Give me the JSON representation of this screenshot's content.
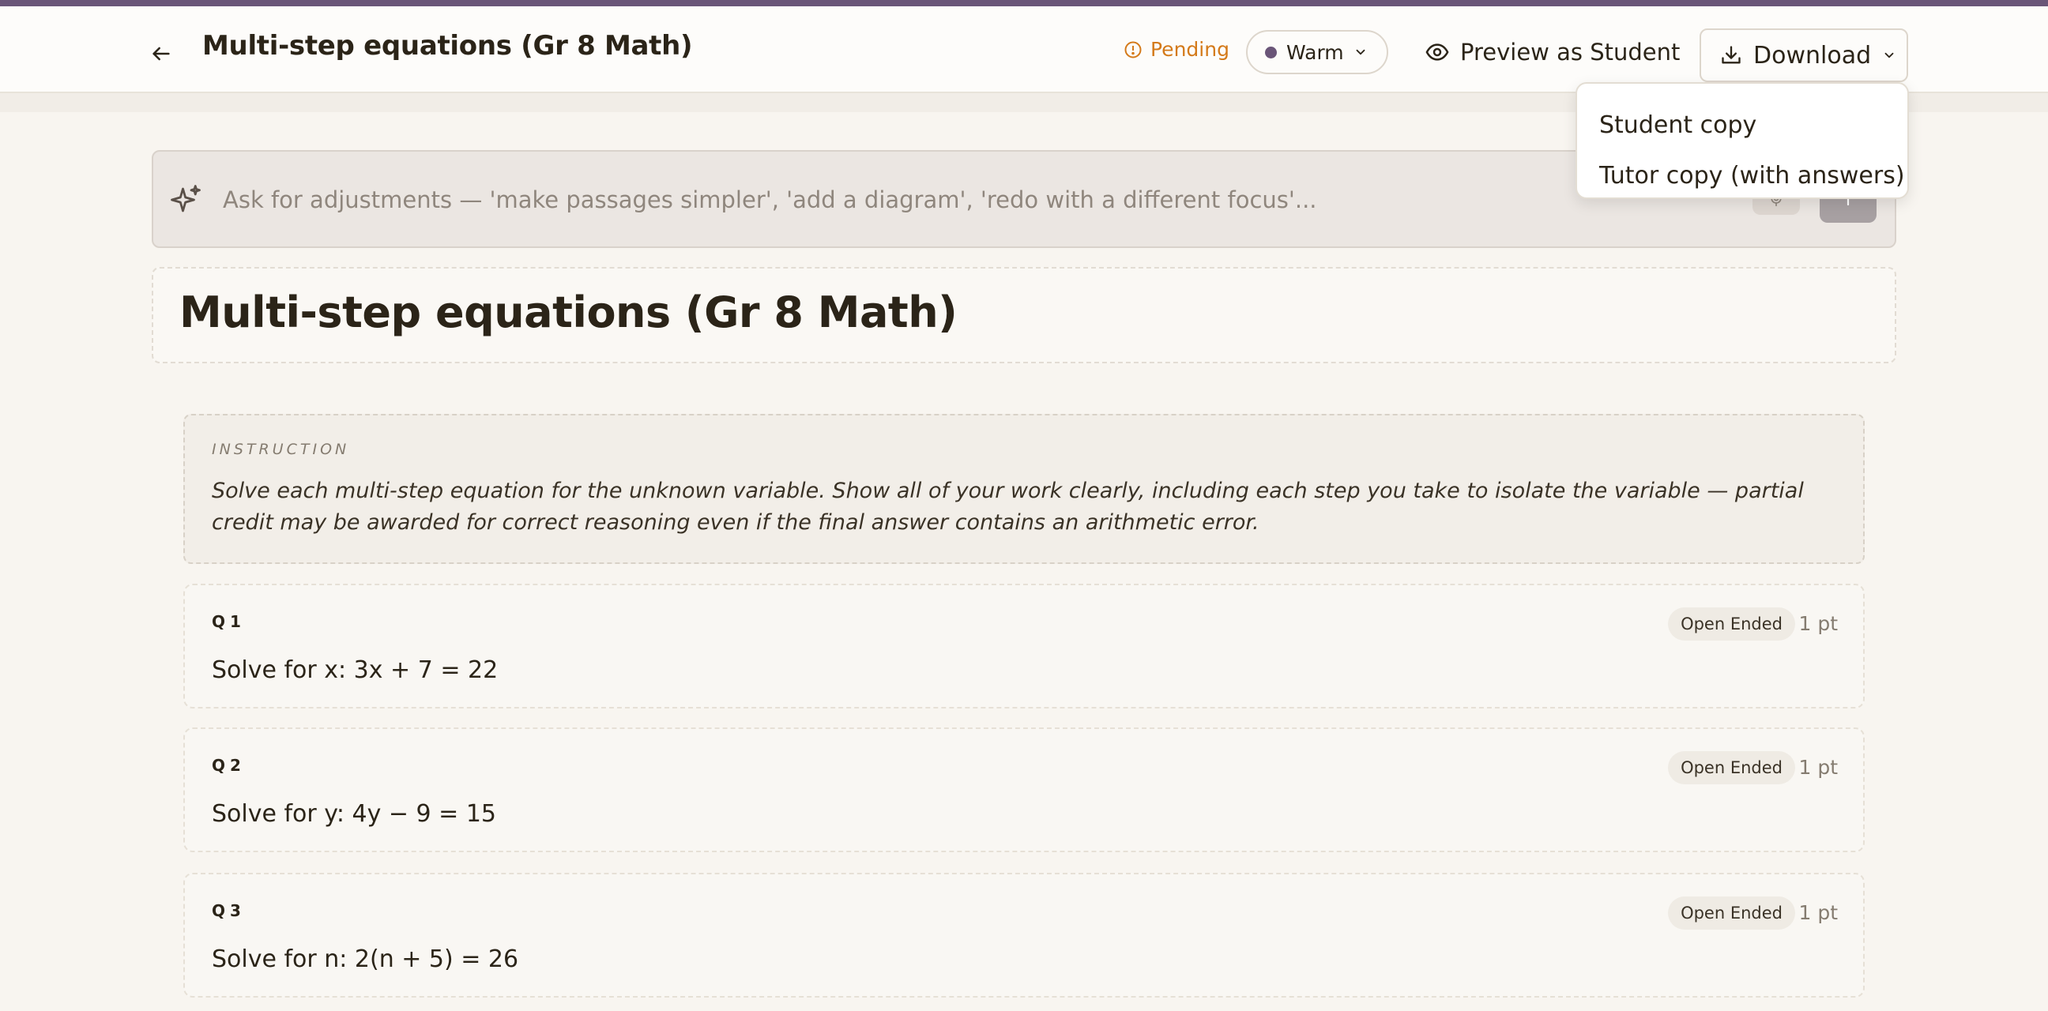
{
  "header": {
    "title": "Multi-step equations (Gr 8 Math)",
    "status": "Pending",
    "tone": "Warm",
    "preview_label": "Preview as Student",
    "download_label": "Download"
  },
  "download_menu": {
    "items": [
      {
        "label": "Student copy"
      },
      {
        "label": "Tutor copy (with answers)"
      }
    ]
  },
  "prompt": {
    "placeholder": "Ask for adjustments — 'make passages simpler', 'add a diagram', 'redo with a different focus'..."
  },
  "document": {
    "title": "Multi-step equations (Gr 8 Math)",
    "instruction_label": "INSTRUCTION",
    "instruction_text": "Solve each multi-step equation for the unknown variable. Show all of your work clearly, including each step you take to isolate the variable — partial credit may be awarded for correct reasoning even if the final answer contains an arithmetic error.",
    "questions": [
      {
        "number": "Q1",
        "text": "Solve for x: 3x + 7 = 22",
        "type": "Open Ended",
        "points": "1 pt"
      },
      {
        "number": "Q2",
        "text": "Solve for y: 4y − 9 = 15",
        "type": "Open Ended",
        "points": "1 pt"
      },
      {
        "number": "Q3",
        "text": "Solve for n: 2(n + 5) = 26",
        "type": "Open Ended",
        "points": "1 pt"
      }
    ]
  },
  "colors": {
    "accent": "#6a5578",
    "pending": "#d47a1a",
    "background": "#f8f5f0"
  },
  "icons": {
    "back": "arrow-left-icon",
    "status": "alert-circle-icon",
    "tone": "dot-icon",
    "preview": "eye-icon",
    "download": "download-icon",
    "prompt": "sparkle-icon",
    "mic": "microphone-icon",
    "send": "send-icon"
  }
}
